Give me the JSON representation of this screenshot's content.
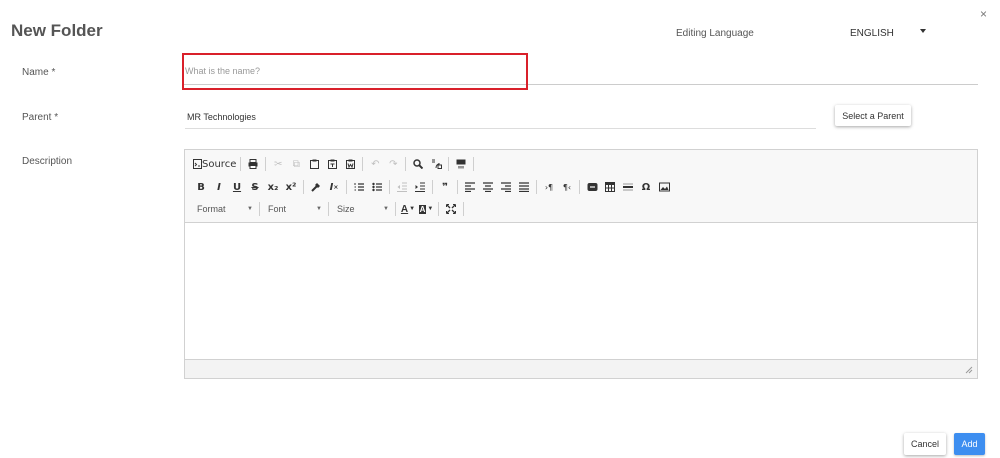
{
  "dialog": {
    "title": "New Folder",
    "close_glyph": "×"
  },
  "language": {
    "label": "Editing Language",
    "selected": "ENGLISH"
  },
  "form": {
    "name_label": "Name *",
    "name_value": "",
    "name_placeholder": "What is the name?",
    "parent_label": "Parent  *",
    "parent_value": "MR Technologies",
    "select_parent_label": "Select a Parent",
    "description_label": "Description"
  },
  "editor": {
    "source_label": "Source",
    "format_label": "Format",
    "font_label": "Font",
    "size_label": "Size",
    "content": ""
  },
  "actions": {
    "cancel_label": "Cancel",
    "add_label": "Add"
  },
  "colors": {
    "highlight": "#d9202a",
    "primary": "#3d8ef0"
  }
}
